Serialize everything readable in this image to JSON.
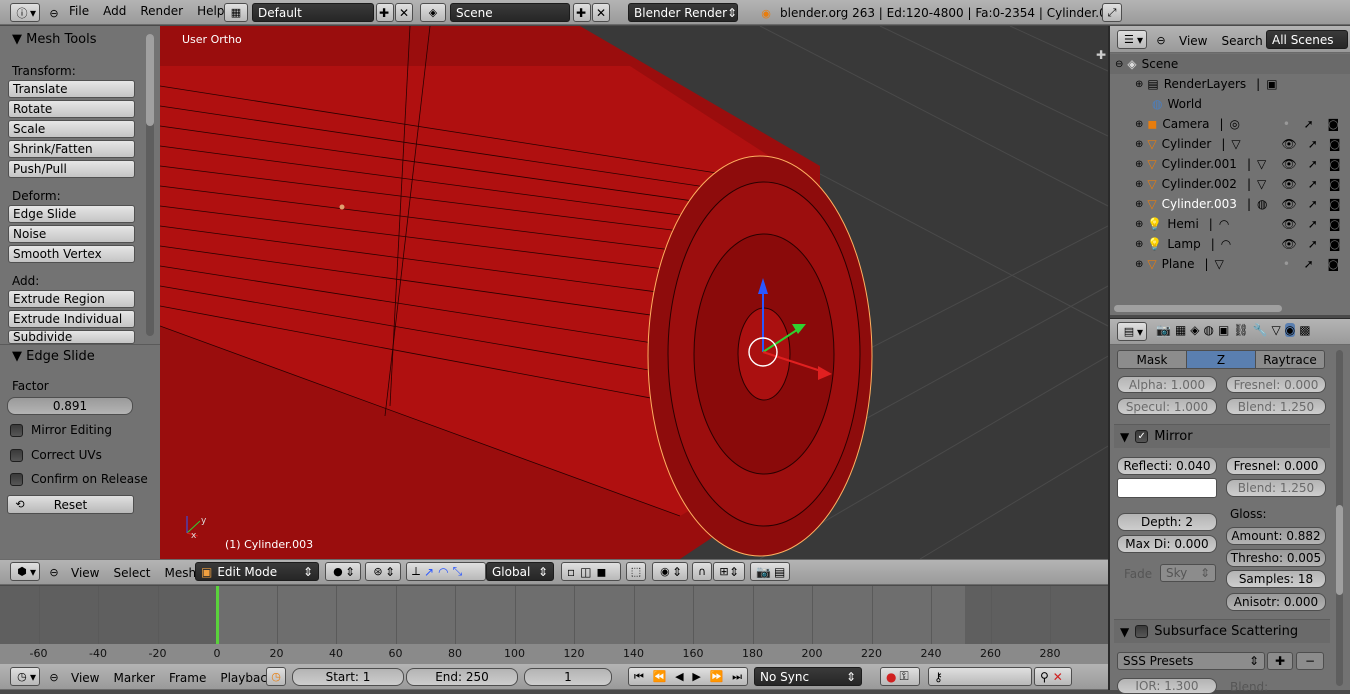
{
  "top": {
    "menus": [
      "File",
      "Add",
      "Render",
      "Help"
    ],
    "layout": "Default",
    "scene": "Scene",
    "engine": "Blender Render",
    "stats": "blender.org 263 | Ed:120-4800 | Fa:0-2354 | Cylinder.003"
  },
  "toolshelf": {
    "title": "Mesh Tools",
    "transform_label": "Transform:",
    "transform": [
      "Translate",
      "Rotate",
      "Scale",
      "Shrink/Fatten",
      "Push/Pull"
    ],
    "deform_label": "Deform:",
    "deform": [
      "Edge Slide",
      "Noise",
      "Smooth Vertex"
    ],
    "add_label": "Add:",
    "add": [
      "Extrude Region",
      "Extrude Individual",
      "Subdivide"
    ]
  },
  "operator": {
    "title": "Edge Slide",
    "factor_label": "Factor",
    "factor": "0.891",
    "mirror_editing": "Mirror Editing",
    "correct_uvs": "Correct UVs",
    "confirm_on_release": "Confirm on Release",
    "reset": "Reset"
  },
  "viewport": {
    "view_name": "User Ortho",
    "object_name": "(1) Cylinder.003"
  },
  "viewport_header": {
    "menus": [
      "View",
      "Select",
      "Mesh"
    ],
    "mode": "Edit Mode",
    "orientation": "Global"
  },
  "outliner": {
    "menus": [
      "View",
      "Search"
    ],
    "filter": "All Scenes",
    "items": [
      {
        "name": "Scene",
        "level": 0
      },
      {
        "name": "RenderLayers",
        "level": 1
      },
      {
        "name": "World",
        "level": 1
      },
      {
        "name": "Camera",
        "level": 1
      },
      {
        "name": "Cylinder",
        "level": 1
      },
      {
        "name": "Cylinder.001",
        "level": 1
      },
      {
        "name": "Cylinder.002",
        "level": 1
      },
      {
        "name": "Cylinder.003",
        "level": 1
      },
      {
        "name": "Hemi",
        "level": 1
      },
      {
        "name": "Lamp",
        "level": 1
      },
      {
        "name": "Plane",
        "level": 1
      }
    ]
  },
  "properties": {
    "tabs": [
      "Mask",
      "Z Transparen",
      "Raytrace"
    ],
    "alpha": "Alpha: 1.000",
    "fresnel1": "Fresnel: 0.000",
    "specular": "Specul: 1.000",
    "blend1": "Blend: 1.250",
    "mirror_title": "Mirror",
    "reflect": "Reflecti: 0.040",
    "fresnel2": "Fresnel: 0.000",
    "blend2": "Blend: 1.250",
    "gloss_label": "Gloss:",
    "depth": "Depth: 2",
    "amount": "Amount: 0.882",
    "maxdist": "Max Di: 0.000",
    "threshold": "Thresho: 0.005",
    "fade_label": "Fade",
    "fade_value": "Sky",
    "samples": "Samples: 18",
    "anisotropy": "Anisotr: 0.000",
    "sss_title": "Subsurface Scattering",
    "sss_presets": "SSS Presets",
    "ior": "IOR: 1.300",
    "blend3": "Blend:"
  },
  "timeline": {
    "ticks": [
      "-60",
      "-40",
      "-20",
      "0",
      "20",
      "40",
      "60",
      "80",
      "100",
      "120",
      "140",
      "160",
      "180",
      "200",
      "220",
      "240",
      "260",
      "280"
    ],
    "current_frame": 0,
    "menus": [
      "View",
      "Marker",
      "Frame",
      "Playback"
    ],
    "start": "Start: 1",
    "end": "End: 250",
    "frame": "1",
    "sync": "No Sync"
  },
  "colors": {
    "mesh": "#b01010",
    "selected": "#ffb060",
    "frame_marker": "#5ad23c"
  }
}
